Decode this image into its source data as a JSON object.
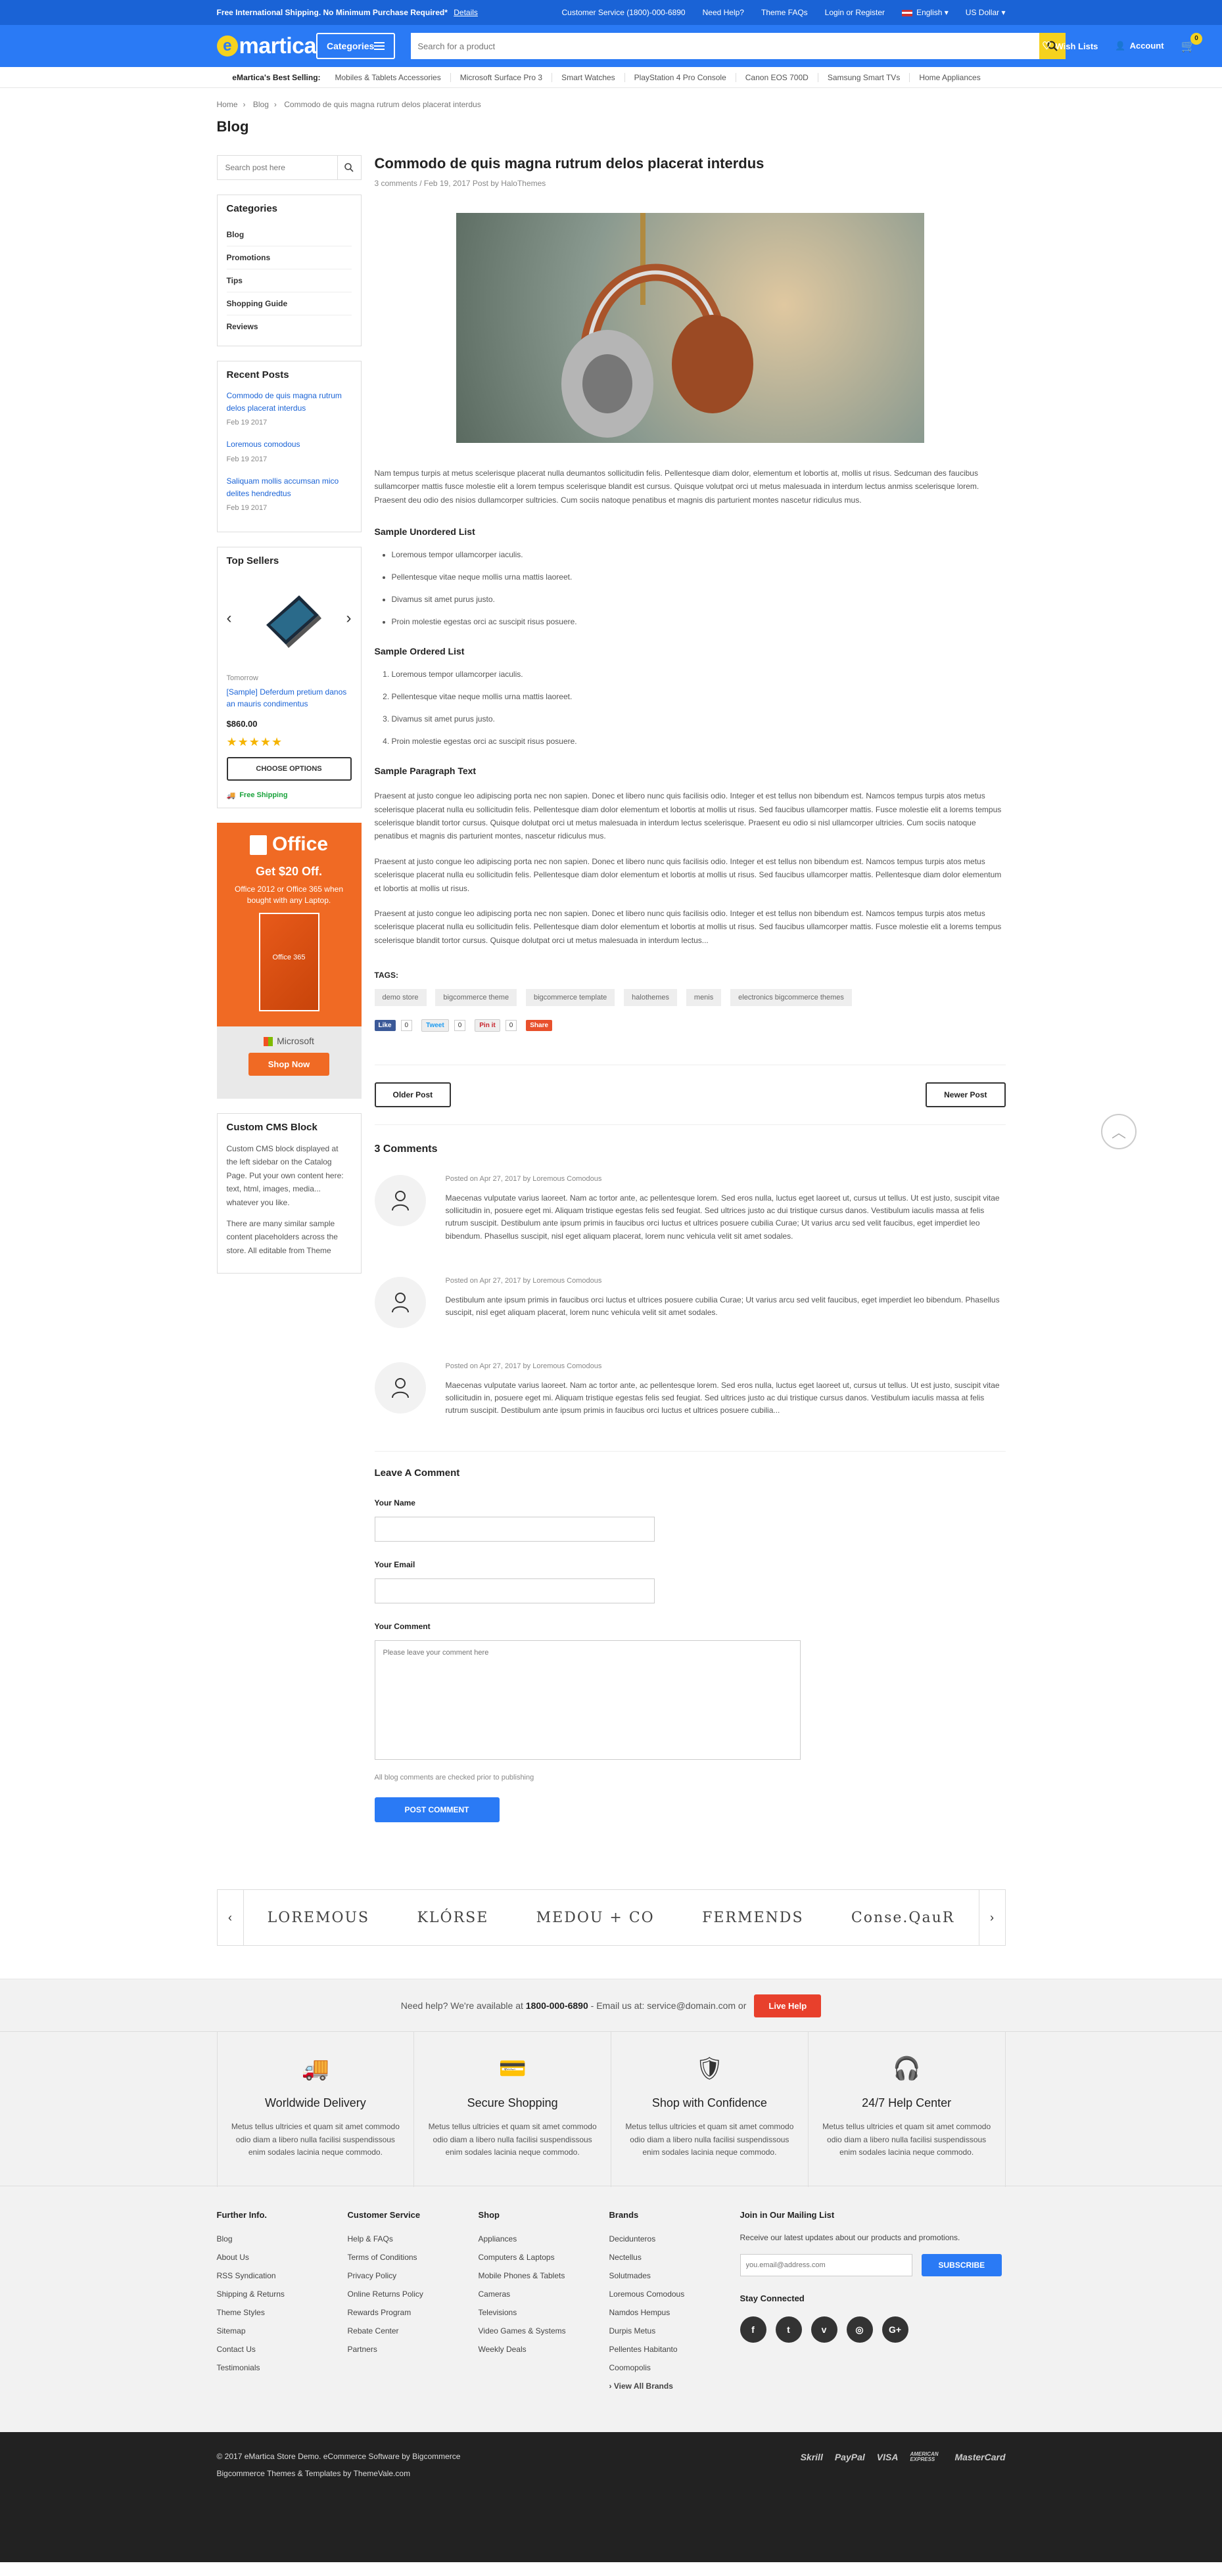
{
  "topbar": {
    "promo": "Free International Shipping. No Minimum Purchase Required*",
    "details": "Details",
    "links": [
      "Customer Service (1800)-000-6890",
      "Need Help?",
      "Theme FAQs",
      "Login or Register"
    ],
    "language": "English",
    "currency": "US Dollar"
  },
  "header": {
    "logo_mark": "e",
    "logo_text": "martica",
    "categories": "Categories",
    "search_placeholder": "Search for a product",
    "wishlist": "Wish Lists",
    "account": "Account",
    "cart_count": "0"
  },
  "best_selling": {
    "label": "eMartica's Best Selling:",
    "items": [
      "Mobiles & Tablets Accessories",
      "Microsoft Surface Pro 3",
      "Smart Watches",
      "PlayStation 4 Pro Console",
      "Canon EOS 700D",
      "Samsung Smart TVs",
      "Home Appliances"
    ]
  },
  "breadcrumb": [
    "Home",
    "Blog",
    "Commodo de quis magna rutrum delos placerat interdus"
  ],
  "page_title": "Blog",
  "sidebar": {
    "search_placeholder": "Search post here",
    "categories_title": "Categories",
    "categories": [
      "Blog",
      "Promotions",
      "Tips",
      "Shopping Guide",
      "Reviews"
    ],
    "recent_title": "Recent Posts",
    "recent": [
      {
        "title": "Commodo de quis magna rutrum delos placerat interdus",
        "date": "Feb 19 2017"
      },
      {
        "title": "Loremous comodous",
        "date": "Feb 19 2017"
      },
      {
        "title": "Saliquam mollis accumsan mico delites hendredtus",
        "date": "Feb 19 2017"
      }
    ],
    "top_sellers_title": "Top Sellers",
    "product": {
      "brand": "Tomorrow",
      "name": "[Sample] Deferdum pretium danos an mauris condimentus",
      "price": "$860.00",
      "rating": 5,
      "stars": "★★★★★",
      "button": "CHOOSE OPTIONS",
      "shipping": "Free Shipping"
    },
    "ad": {
      "title": "Office",
      "offer": "Get $20 Off.",
      "desc": "Office 2012 or Office 365 when bought with any Laptop.",
      "box_label": "Office 365",
      "brand": "Microsoft",
      "button": "Shop Now"
    },
    "cms_title": "Custom CMS Block",
    "cms_p1": "Custom CMS block displayed at the left sidebar on the Catalog Page. Put your own content here: text, html, images, media... whatever you like.",
    "cms_p2": "There are many similar sample content placeholders across the store. All editable from Theme"
  },
  "post": {
    "title": "Commodo de quis magna rutrum delos placerat interdus",
    "meta": "3 comments / Feb 19, 2017 Post by HaloThemes",
    "intro": "Nam tempus turpis at metus scelerisque placerat nulla deumantos sollicitudin felis. Pellentesque diam dolor, elementum et lobortis at, mollis ut risus. Sedcuman des faucibus sullamcorper mattis fusce molestie elit a lorem tempus scelerisque blandit est cursus. Quisque volutpat orci ut metus malesuada in interdum lectus anmiss scelerisque lorem. Praesent deu odio des nisios dullamcorper sultricies. Cum sociis natoque penatibus et magnis dis parturient montes nascetur ridiculus mus.",
    "ul_title": "Sample Unordered List",
    "ul": [
      "Loremous tempor ullamcorper iaculis.",
      "Pellentesque vitae neque mollis urna mattis laoreet.",
      "Divamus sit amet purus justo.",
      "Proin molestie egestas orci ac suscipit risus posuere."
    ],
    "ol_title": "Sample Ordered List",
    "ol": [
      "Loremous tempor ullamcorper iaculis.",
      "Pellentesque vitae neque mollis urna mattis laoreet.",
      "Divamus sit amet purus justo.",
      "Proin molestie egestas orci ac suscipit risus posuere."
    ],
    "para_title": "Sample Paragraph Text",
    "para1": "Praesent at justo congue leo adipiscing porta nec non sapien. Donec et libero nunc quis facilisis odio. Integer et est tellus non bibendum est. Namcos tempus turpis atos metus scelerisque placerat nulla eu sollicitudin felis. Pellentesque diam dolor elementum et lobortis at mollis ut risus. Sed faucibus ullamcorper mattis. Fusce molestie elit a lorems tempus scelerisque blandit tortor cursus. Quisque dolutpat orci ut metus malesuada in interdum lectus scelerisque. Praesent eu odio si nisl ullamcorper ultricies. Cum sociis natoque penatibus et magnis dis parturient montes, nascetur ridiculus mus.",
    "para2": "Praesent at justo congue leo adipiscing porta nec non sapien. Donec et libero nunc quis facilisis odio. Integer et est tellus non bibendum est. Namcos tempus turpis atos metus scelerisque placerat nulla eu sollicitudin felis. Pellentesque diam dolor elementum et lobortis at mollis ut risus. Sed faucibus ullamcorper mattis. Pellentesque diam dolor elementum et lobortis at mollis ut risus.",
    "para3": "Praesent at justo congue leo adipiscing porta nec non sapien. Donec et libero nunc quis facilisis odio. Integer et est tellus non bibendum est. Namcos tempus turpis atos metus scelerisque placerat nulla eu sollicitudin felis. Pellentesque diam dolor elementum et lobortis at mollis ut risus. Sed faucibus ullamcorper mattis. Fusce molestie elit a lorems tempus scelerisque blandit tortor cursus. Quisque dolutpat orci ut metus malesuada in interdum lectus...",
    "tags_label": "TAGS:",
    "tags": [
      "demo store",
      "bigcommerce theme",
      "bigcommerce template",
      "halothemes",
      "menis",
      "electronics bigcommerce themes"
    ],
    "social": {
      "like": "Like",
      "like_count": "0",
      "tweet": "Tweet",
      "tweet_count": "0",
      "pin": "Pin it",
      "pin_count": "0",
      "share": "Share"
    },
    "older": "Older Post",
    "newer": "Newer Post"
  },
  "comments": {
    "title": "3 Comments",
    "items": [
      {
        "by": "Posted on Apr 27, 2017 by Loremous Comodous",
        "text": "Maecenas vulputate varius laoreet. Nam ac tortor ante, ac pellentesque lorem. Sed eros nulla, luctus eget laoreet ut, cursus ut tellus. Ut est justo, suscipit vitae sollicitudin in, posuere eget mi. Aliquam tristique egestas felis sed feugiat. Sed ultrices justo ac dui tristique cursus danos. Vestibulum iaculis massa at felis rutrum suscipit. Destibulum ante ipsum primis in faucibus orci luctus et ultrices posuere cubilia Curae; Ut varius arcu sed velit faucibus, eget imperdiet leo bibendum. Phasellus suscipit, nisl eget aliquam placerat, lorem nunc vehicula velit sit amet sodales."
      },
      {
        "by": "Posted on Apr 27, 2017 by Loremous Comodous",
        "text": "Destibulum ante ipsum primis in faucibus orci luctus et ultrices posuere cubilia Curae; Ut varius arcu sed velit faucibus, eget imperdiet leo bibendum. Phasellus suscipit, nisl eget aliquam placerat, lorem nunc vehicula velit sit amet sodales."
      },
      {
        "by": "Posted on Apr 27, 2017 by Loremous Comodous",
        "text": "Maecenas vulputate varius laoreet. Nam ac tortor ante, ac pellentesque lorem. Sed eros nulla, luctus eget laoreet ut, cursus ut tellus. Ut est justo, suscipit vitae sollicitudin in, posuere eget mi. Aliquam tristique egestas felis sed feugiat. Sed ultrices justo ac dui tristique cursus danos. Vestibulum iaculis massa at felis rutrum suscipit. Destibulum ante ipsum primis in faucibus orci luctus et ultrices posuere cubilia..."
      }
    ]
  },
  "form": {
    "title": "Leave A Comment",
    "name_label": "Your Name",
    "email_label": "Your Email",
    "comment_label": "Your Comment",
    "comment_placeholder": "Please leave your comment here",
    "note": "All blog comments are checked prior to publishing",
    "button": "POST COMMENT"
  },
  "brands": [
    "LOREMOUS",
    "KLÓRSE",
    "MEDOU + CO",
    "FERMENDS",
    "Conse.QauR"
  ],
  "help": {
    "text": "Need help? We're available at",
    "phone": "1800-000-6890",
    "email_text": "- Email us at: service@domain.com or",
    "button": "Live Help"
  },
  "features": [
    {
      "title": "Worldwide Delivery",
      "text": "Metus tellus ultricies et quam sit amet commodo odio diam a libero nulla facilisi suspendissous enim sodales lacinia neque commodo."
    },
    {
      "title": "Secure Shopping",
      "text": "Metus tellus ultricies et quam sit amet commodo odio diam a libero nulla facilisi suspendissous enim sodales lacinia neque commodo."
    },
    {
      "title": "Shop with Confidence",
      "text": "Metus tellus ultricies et quam sit amet commodo odio diam a libero nulla facilisi suspendissous enim sodales lacinia neque commodo."
    },
    {
      "title": "24/7 Help Center",
      "text": "Metus tellus ultricies et quam sit amet commodo odio diam a libero nulla facilisi suspendissous enim sodales lacinia neque commodo."
    }
  ],
  "footer": {
    "cols": [
      {
        "title": "Further Info.",
        "links": [
          "Blog",
          "About Us",
          "RSS Syndication",
          "Shipping & Returns",
          "Theme Styles",
          "Sitemap",
          "Contact Us",
          "Testimonials"
        ]
      },
      {
        "title": "Customer Service",
        "links": [
          "Help & FAQs",
          "Terms of Conditions",
          "Privacy Policy",
          "Online Returns Policy",
          "Rewards Program",
          "Rebate Center",
          "Partners"
        ]
      },
      {
        "title": "Shop",
        "links": [
          "Appliances",
          "Computers & Laptops",
          "Mobile Phones & Tablets",
          "Cameras",
          "Televisions",
          "Video Games & Systems",
          "Weekly Deals"
        ]
      },
      {
        "title": "Brands",
        "links": [
          "Decidunteros",
          "Nectellus",
          "Solutmades",
          "Loremous Comodous",
          "Namdos Hempus",
          "Durpis Metus",
          "Pellentes Habitanto",
          "Coomopolis",
          "View All Brands"
        ]
      }
    ],
    "mail_title": "Join in Our Mailing List",
    "mail_text": "Receive our latest updates about our products and promotions.",
    "mail_placeholder": "you.email@address.com",
    "subscribe": "SUBSCRIBE",
    "stay": "Stay Connected",
    "social": [
      "f",
      "t",
      "v",
      "◎",
      "G+"
    ]
  },
  "bottom": {
    "copy": "© 2017 eMartica Store Demo. eCommerce Software by Bigcommerce",
    "credit": "Bigcommerce Themes & Templates by ThemeVale.com",
    "payments": [
      "Skrill",
      "PayPal",
      "VISA",
      "AMERICAN EXPRESS",
      "MasterCard"
    ]
  }
}
